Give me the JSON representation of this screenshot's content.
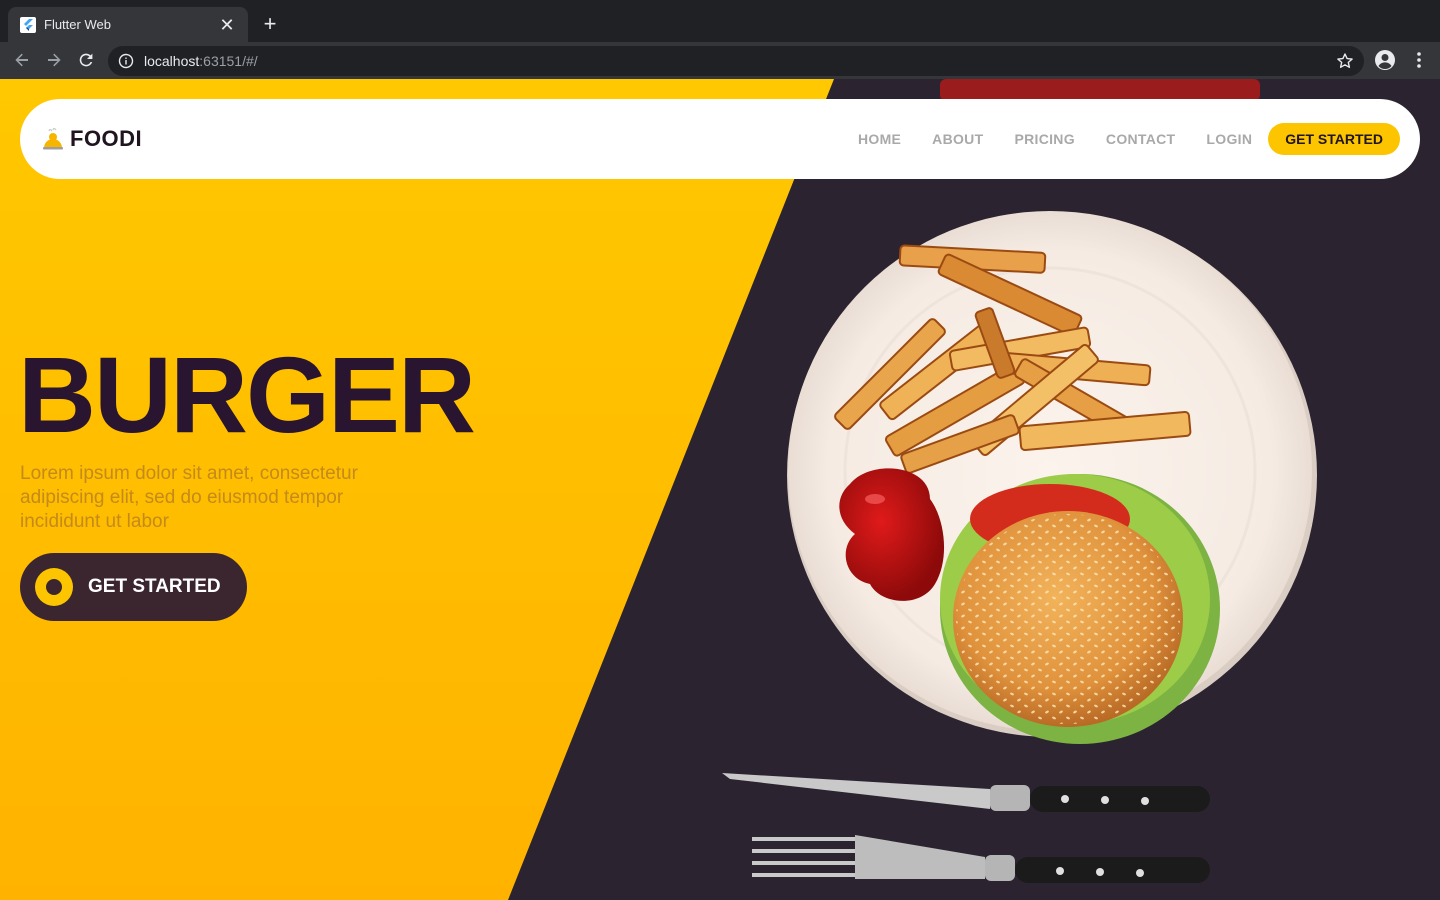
{
  "browser": {
    "tab_title": "Flutter Web",
    "url_host": "localhost",
    "url_rest": ":63151/#/"
  },
  "icons": {
    "tab_favicon": "flutter-logo-icon",
    "tab_close": "close-icon",
    "new_tab": "plus-icon",
    "back": "arrow-back-icon",
    "forward": "arrow-forward-icon",
    "reload": "reload-icon",
    "info": "info-icon",
    "bookmark": "star-icon",
    "profile": "account-icon",
    "menu": "more-vert-icon",
    "logo": "chef-hat-icon",
    "hero_button": "ring-icon"
  },
  "navbar": {
    "brand": "FOODI",
    "links": [
      "HOME",
      "ABOUT",
      "PRICING",
      "CONTACT",
      "LOGIN"
    ],
    "cta": "GET STARTED"
  },
  "hero": {
    "title": "BURGER",
    "description": "Lorem ipsum dolor sit amet, consectetur adipiscing elit, sed do eiusmod tempor incididunt ut labor",
    "button": "GET STARTED"
  },
  "colors": {
    "accent": "#fcc500",
    "dark": "#2a1530",
    "button_bg": "#3b2630",
    "browser_bg": "#202124",
    "browser_toolbar": "#35363a"
  }
}
